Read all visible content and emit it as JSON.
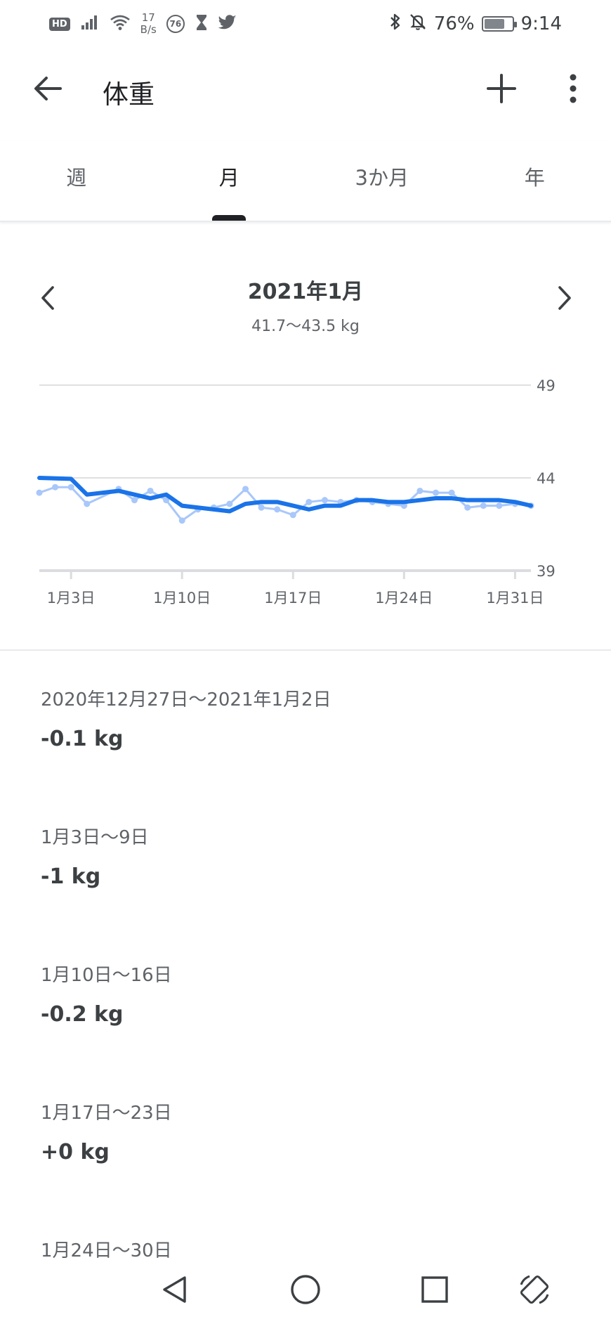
{
  "status_bar": {
    "hd": "HD",
    "net_speed_value": "17",
    "net_speed_unit": "B/s",
    "badge": "76",
    "battery": "76%",
    "battery_level": 0.76,
    "time": "9:14"
  },
  "app_bar": {
    "title": "体重",
    "back_icon": "arrow-left-icon",
    "add_icon": "plus-icon",
    "more_icon": "more-vertical-icon"
  },
  "tabs": [
    {
      "label": "週",
      "active": false
    },
    {
      "label": "月",
      "active": true
    },
    {
      "label": "3か月",
      "active": false
    },
    {
      "label": "年",
      "active": false
    }
  ],
  "period": {
    "title": "2021年1月",
    "range": "41.7〜43.5 kg"
  },
  "colors": {
    "trend_line": "#1a73e8",
    "daily_line": "#a8c7fa",
    "grid": "#e0e0e0"
  },
  "chart_data": {
    "type": "line",
    "x_tick_labels": [
      "1月3日",
      "1月10日",
      "1月17日",
      "1月24日",
      "1月31日"
    ],
    "x_tick_days": [
      3,
      10,
      17,
      24,
      31
    ],
    "y_tick_labels": [
      "49",
      "44",
      "39"
    ],
    "ylim": [
      39,
      49
    ],
    "xlim": [
      1,
      32
    ],
    "grid": true,
    "series": [
      {
        "role": "daily",
        "x": [
          1,
          2,
          3,
          4,
          6,
          7,
          8,
          9,
          10,
          11,
          12,
          13,
          14,
          15,
          16,
          17,
          18,
          19,
          20,
          21,
          22,
          23,
          24,
          25,
          26,
          27,
          28,
          29,
          30,
          31,
          32
        ],
        "y": [
          43.2,
          43.5,
          43.5,
          42.6,
          43.4,
          42.8,
          43.3,
          42.8,
          41.7,
          42.3,
          42.4,
          42.6,
          43.4,
          42.4,
          42.3,
          42.0,
          42.7,
          42.8,
          42.7,
          42.8,
          42.7,
          42.6,
          42.5,
          43.3,
          43.2,
          43.2,
          42.4,
          42.5,
          42.5,
          42.6,
          42.5
        ]
      },
      {
        "role": "trend",
        "x": [
          1,
          3,
          4,
          6,
          8,
          9,
          10,
          12,
          13,
          14,
          15,
          16,
          17,
          18,
          19,
          20,
          21,
          22,
          23,
          24,
          25,
          26,
          27,
          28,
          29,
          30,
          31,
          32
        ],
        "y": [
          44.0,
          43.95,
          43.1,
          43.3,
          42.9,
          43.1,
          42.5,
          42.3,
          42.2,
          42.6,
          42.7,
          42.7,
          42.5,
          42.3,
          42.5,
          42.5,
          42.8,
          42.8,
          42.7,
          42.7,
          42.8,
          42.9,
          42.9,
          42.8,
          42.8,
          42.8,
          42.7,
          42.5
        ]
      }
    ]
  },
  "weeks": [
    {
      "range": "2020年12月27日〜2021年1月2日",
      "change": "-0.1 kg"
    },
    {
      "range": "1月3日〜9日",
      "change": "-1 kg"
    },
    {
      "range": "1月10日〜16日",
      "change": "-0.2 kg"
    },
    {
      "range": "1月17日〜23日",
      "change": "+0 kg"
    },
    {
      "range": "1月24日〜30日",
      "change": ""
    }
  ],
  "nav_bar": {
    "back_icon": "triangle-back-icon",
    "home_icon": "circle-home-icon",
    "recents_icon": "square-recents-icon",
    "rotate_icon": "rotate-screen-icon"
  }
}
